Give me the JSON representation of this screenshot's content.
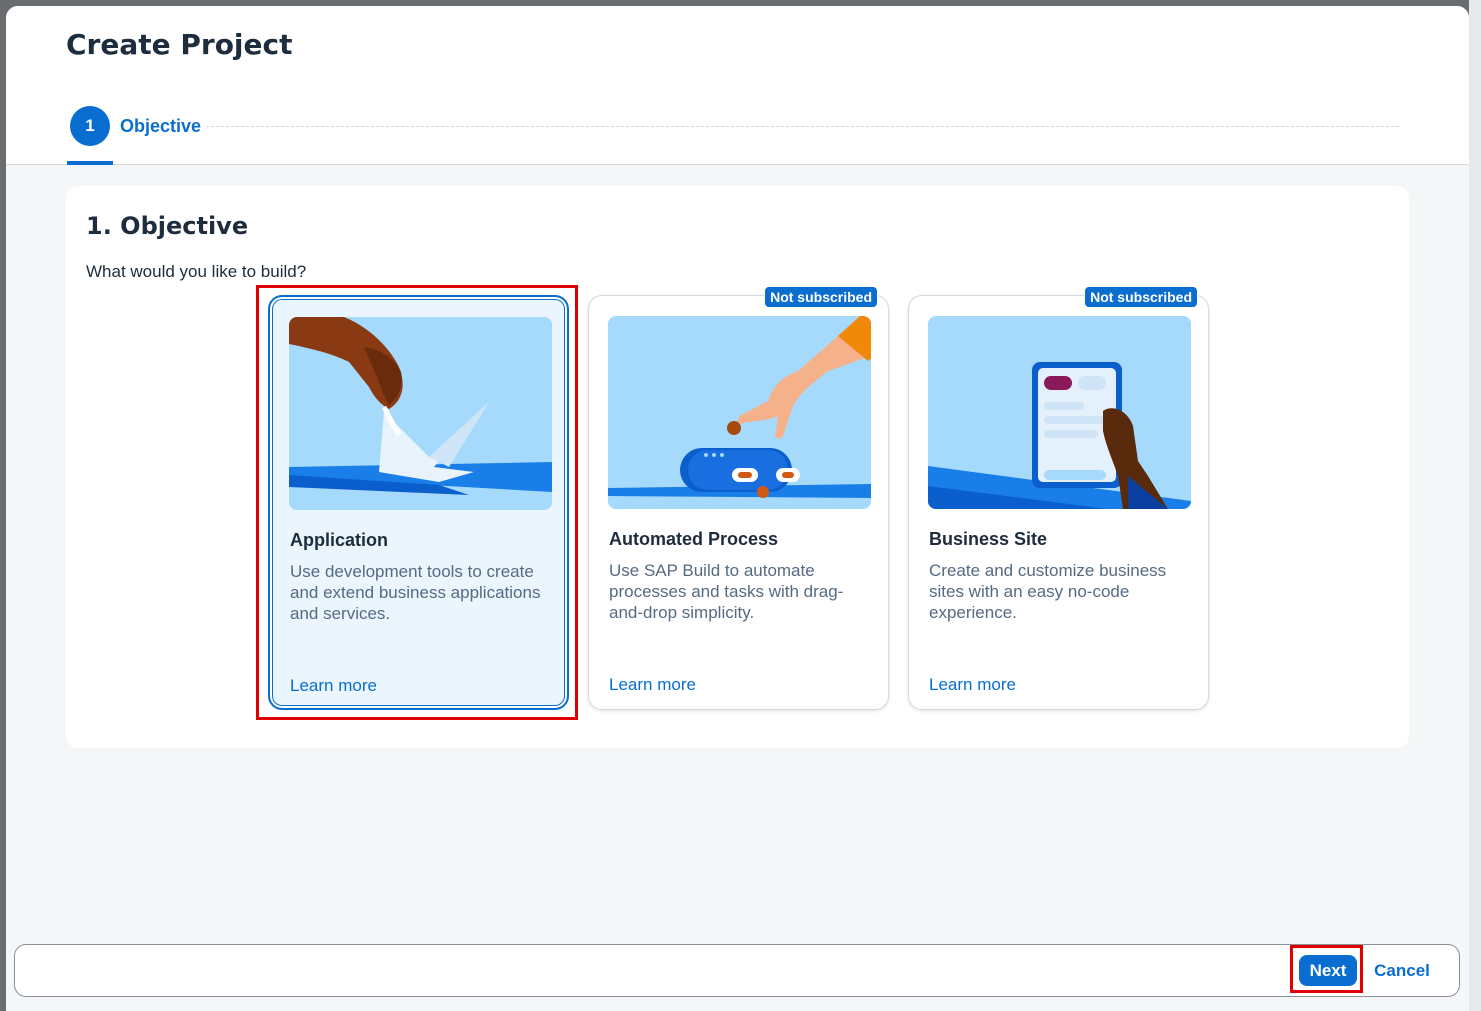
{
  "dialog": {
    "title": "Create Project",
    "steps": [
      {
        "number": "1",
        "label": "Objective"
      }
    ]
  },
  "content": {
    "section_title": "1. Objective",
    "question": "What would you like to build?",
    "cards": [
      {
        "title": "Application",
        "description": "Use development tools to create and extend business applications and services.",
        "link": "Learn more",
        "selected": true,
        "badge": ""
      },
      {
        "title": "Automated Process",
        "description": "Use SAP Build to automate processes and tasks with drag-and-drop simplicity.",
        "link": "Learn more",
        "selected": false,
        "badge": "Not subscribed"
      },
      {
        "title": "Business Site",
        "description": "Create and customize business sites with an easy no-code experience.",
        "link": "Learn more",
        "selected": false,
        "badge": "Not subscribed"
      }
    ]
  },
  "footer": {
    "next_label": "Next",
    "cancel_label": "Cancel"
  },
  "colors": {
    "accent": "#0a6ed1",
    "highlight": "#e00000",
    "title_text": "#1d2d3e"
  }
}
